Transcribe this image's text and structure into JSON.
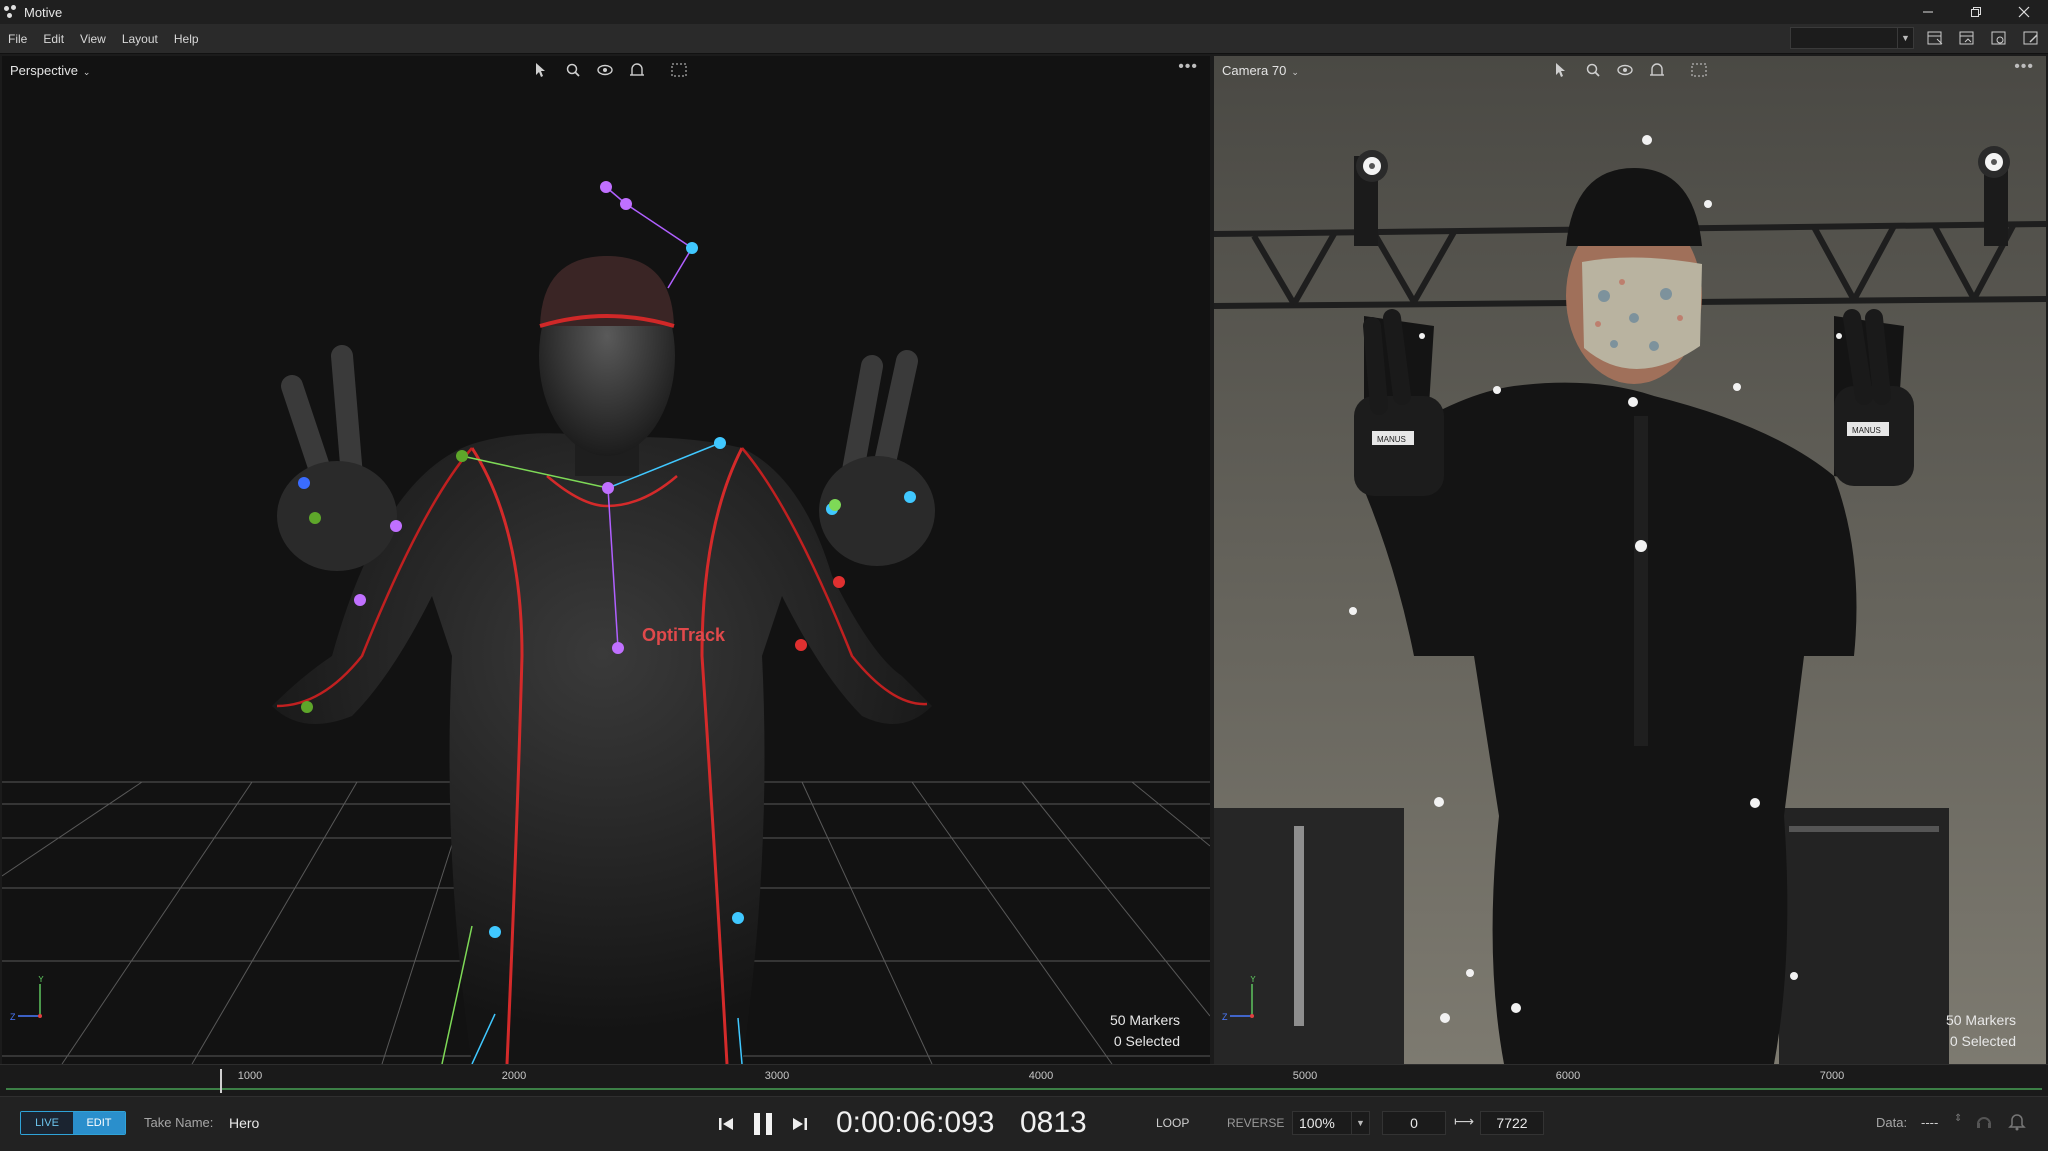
{
  "window": {
    "title": "Motive"
  },
  "menu": [
    "File",
    "Edit",
    "View",
    "Layout",
    "Help"
  ],
  "viewports": {
    "left": {
      "title": "Perspective",
      "markers": "50 Markers",
      "selected": "0 Selected",
      "brand": "OptiTrack"
    },
    "right": {
      "title": "Camera  70",
      "markers": "50 Markers",
      "selected": "0 Selected",
      "glove_label": "MANUS"
    }
  },
  "timeline": {
    "ticks": [
      "1000",
      "2000",
      "3000",
      "4000",
      "5000",
      "6000",
      "7000"
    ]
  },
  "transport": {
    "live_label": "LIVE",
    "edit_label": "EDIT",
    "take_label": "Take Name:",
    "take_name": "Hero",
    "timecode": "0:00:06:093",
    "frame": "0813",
    "loop_label": "LOOP",
    "reverse_label": "REVERSE",
    "speed": "100%",
    "range_start": "0",
    "range_end": "7722",
    "data_label": "Data:",
    "data_value": "----"
  },
  "colors": {
    "accent": "#2a8fcc",
    "marker_purple": "#b060ff",
    "marker_cyan": "#40c8ff",
    "marker_green": "#7ed957",
    "suit_red": "#e03030"
  }
}
